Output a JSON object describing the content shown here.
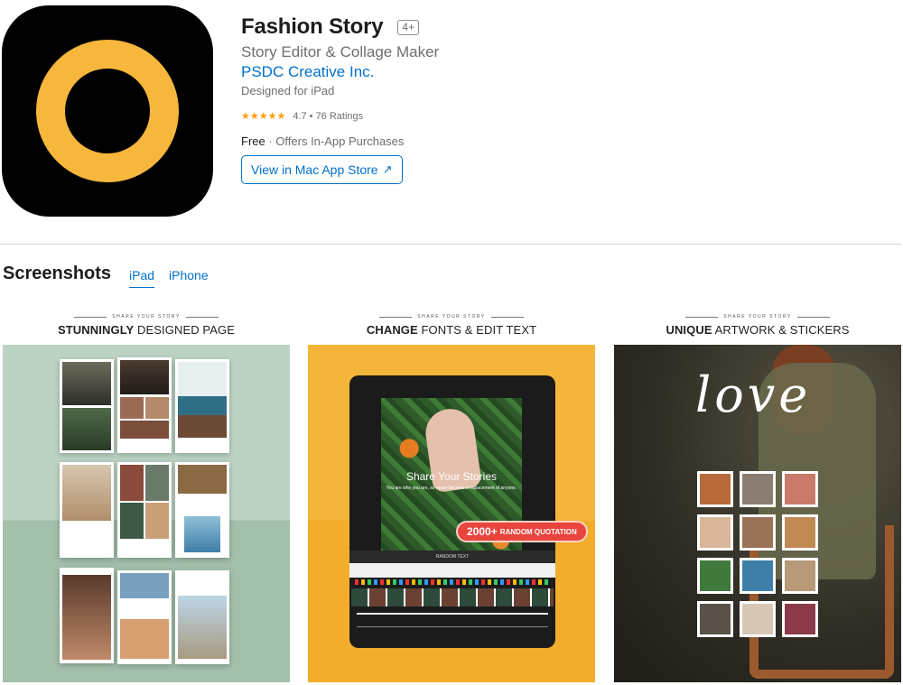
{
  "app": {
    "title": "Fashion Story",
    "age_rating": "4+",
    "subtitle": "Story Editor & Collage Maker",
    "developer": "PSDC Creative Inc.",
    "designed_for": "Designed for iPad",
    "rating_stars": "★★★★★",
    "rating_text": "4.7 • 76 Ratings",
    "price": "Free",
    "price_note": "· Offers In-App Purchases",
    "store_button": "View in Mac App Store",
    "store_button_icon": "↗"
  },
  "screenshots": {
    "title": "Screenshots",
    "tabs": [
      {
        "label": "iPad",
        "active": true
      },
      {
        "label": "iPhone",
        "active": false
      }
    ],
    "items": [
      {
        "kicker": "SHARE YOUR STORY",
        "caption_bold": "STUNNINGLY",
        "caption_rest": " DESIGNED PAGE"
      },
      {
        "kicker": "SHARE YOUR STORY",
        "caption_bold": "CHANGE",
        "caption_rest": " FONTS & EDIT TEXT"
      },
      {
        "kicker": "SHARE YOUR STORY",
        "caption_bold": "UNIQUE",
        "caption_rest": " ARTWORK & STICKERS"
      }
    ],
    "shot2": {
      "overlay_title": "Share Your Stories",
      "overlay_sub": "You are who you are, so never become a replacement of anyone.",
      "badge_number": "2000+",
      "badge_label": "RANDOM QUOTATION",
      "random_text": "RANDOM TEXT"
    },
    "shot3": {
      "lettering": "love"
    }
  },
  "colors": {
    "link_blue": "#0070c9",
    "icon_ring": "#f6b73c",
    "star": "#ff9f0a",
    "panel1": "#bcd3c4",
    "panel2": "#f4b63a"
  }
}
